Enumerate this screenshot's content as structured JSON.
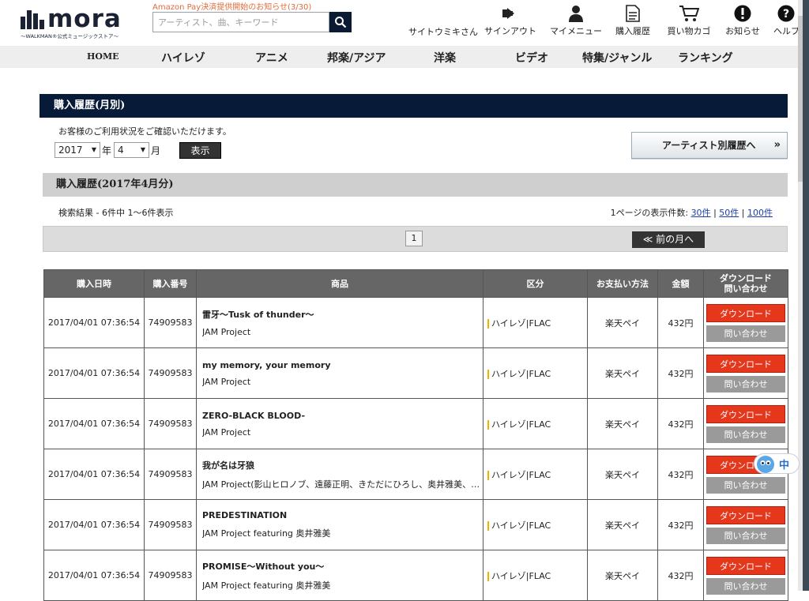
{
  "header": {
    "logo_text": "mora",
    "logo_sub": "〜WALKMAN®公式ミュージックストア〜",
    "notice": "Amazon Pay決済提供開始のお知らせ(3/30)",
    "search_placeholder": "アーティスト、曲、キーワード",
    "user_name": "サイトウミキさん",
    "nav": {
      "signout": "サインアウト",
      "mymenu": "マイメニュー",
      "history": "購入履歴",
      "cart": "買い物カゴ",
      "news": "お知らせ",
      "help": "ヘルプ"
    }
  },
  "categories": [
    "HOME",
    "ハイレゾ",
    "アニメ",
    "邦楽/アジア",
    "洋楽",
    "ビデオ",
    "特集/ジャンル",
    "ランキング"
  ],
  "monthly": {
    "title": "購入履歴(月別)",
    "intro": "お客様のご利用状況をご確認いただけます。",
    "year": "2017",
    "year_unit": "年",
    "month": "4",
    "month_unit": "月",
    "show_button": "表示",
    "artist_button": "アーティスト別履歴へ",
    "artist_chevron": "»"
  },
  "history": {
    "title": "購入履歴(2017年4月分)",
    "result_count": "検索結果 - 6件中 1〜6件表示",
    "per_page_label": "1ページの表示件数:",
    "per_page_30": "30件",
    "per_page_50": "50件",
    "per_page_100": "100件",
    "separator": "|",
    "page_current": "1",
    "prev_month": "≪ 前の月へ"
  },
  "table": {
    "headers": {
      "date": "購入日時",
      "order": "購入番号",
      "product": "商品",
      "category": "区分",
      "payment": "お支払い方法",
      "amount": "金額",
      "download_line1": "ダウンロード",
      "download_line2": "問い合わせ"
    },
    "download_label": "ダウンロード",
    "inquiry_label": "問い合わせ",
    "rows": [
      {
        "date": "2017/04/01 07:36:54",
        "order": "74909583",
        "title": "雷牙〜Tusk of thunder〜",
        "artist": "JAM Project",
        "category": "ハイレゾ|FLAC",
        "payment": "楽天ペイ",
        "amount": "432円"
      },
      {
        "date": "2017/04/01 07:36:54",
        "order": "74909583",
        "title": "my memory, your memory",
        "artist": "JAM Project",
        "category": "ハイレゾ|FLAC",
        "payment": "楽天ペイ",
        "amount": "432円"
      },
      {
        "date": "2017/04/01 07:36:54",
        "order": "74909583",
        "title": "ZERO-BLACK BLOOD-",
        "artist": "JAM Project",
        "category": "ハイレゾ|FLAC",
        "payment": "楽天ペイ",
        "amount": "432円"
      },
      {
        "date": "2017/04/01 07:36:54",
        "order": "74909583",
        "title": "我が名は牙狼",
        "artist": "JAM Project(影山ヒロノブ、遠藤正明、きただにひろし、奥井雅美、…",
        "category": "ハイレゾ|FLAC",
        "payment": "楽天ペイ",
        "amount": "432円"
      },
      {
        "date": "2017/04/01 07:36:54",
        "order": "74909583",
        "title": "PREDESTINATION",
        "artist": "JAM Project featuring 奥井雅美",
        "category": "ハイレゾ|FLAC",
        "payment": "楽天ペイ",
        "amount": "432円"
      },
      {
        "date": "2017/04/01 07:36:54",
        "order": "74909583",
        "title": "PROMISE〜Without you〜",
        "artist": "JAM Project featuring 奥井雅美",
        "category": "ハイレゾ|FLAC",
        "payment": "楽天ペイ",
        "amount": "432円"
      }
    ]
  },
  "ime": {
    "label": "中"
  },
  "colors": {
    "navy": "#071a38",
    "download_red": "#e4371c",
    "inquiry_gray": "#9a9a9a",
    "header_gray": "#666666",
    "hires_yellow": "#e8b400"
  }
}
